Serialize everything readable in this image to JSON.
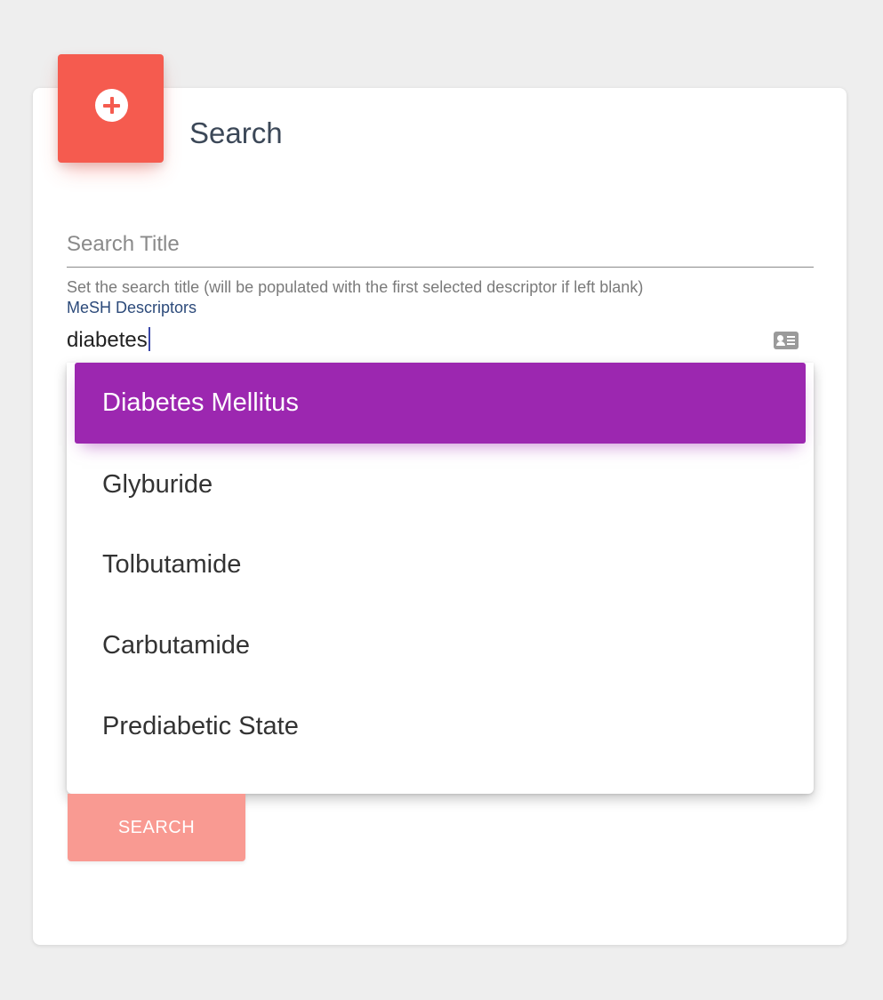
{
  "card": {
    "title": "Search",
    "header_icon": "plus-circle-icon",
    "accent_color": "#f55b4f"
  },
  "search_title_field": {
    "placeholder": "Search Title",
    "value": "",
    "helper_text": "Set the search title (will be populated with the first selected descriptor if left blank)"
  },
  "mesh_field": {
    "label": "MeSH Descriptors",
    "value": "diabetes",
    "trailing_icon": "id-card-icon"
  },
  "autocomplete": {
    "highlight_color": "#9c27b0",
    "active_index": 0,
    "options": [
      "Diabetes Mellitus",
      "Glyburide",
      "Tolbutamide",
      "Carbutamide",
      "Prediabetic State"
    ]
  },
  "search_button": {
    "label": "SEARCH"
  }
}
